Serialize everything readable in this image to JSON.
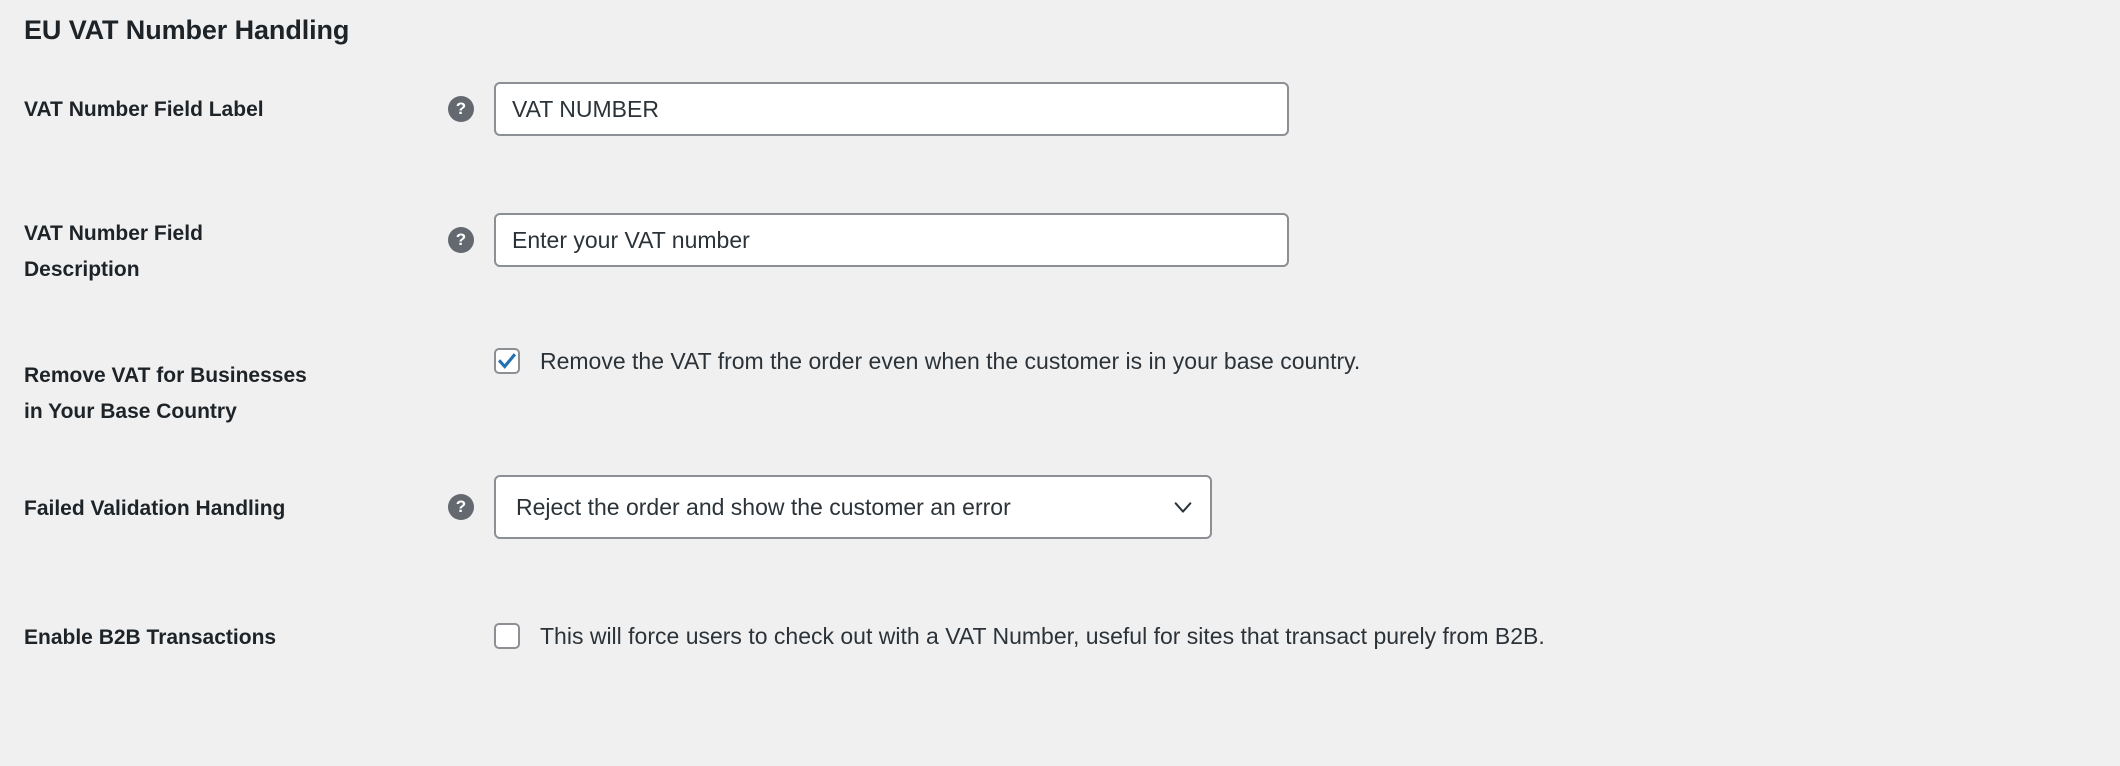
{
  "page": {
    "section_title": "EU VAT Number Handling",
    "background_color": "#f0f0f1",
    "text_color": "#1d2327",
    "border_color": "#8c8f94",
    "accent_color": "#2271b1",
    "help_icon_color": "#646970",
    "help_icon_glyph": "?"
  },
  "rows": {
    "vat_field_label": {
      "label": "VAT Number Field Label",
      "help": "?",
      "value": "VAT NUMBER",
      "placeholder": "VAT NUMBER"
    },
    "vat_field_description": {
      "label_line1": "VAT Number Field",
      "label_line2": "Description",
      "help": "?",
      "value": "Enter your VAT number",
      "placeholder": "Enter your VAT number"
    },
    "remove_vat_base_country": {
      "label_line1": "Remove VAT for Businesses",
      "label_line2": "in Your Base Country",
      "checkbox_label": "Remove the VAT from the order even when the customer is in your base country.",
      "checked": "true"
    },
    "failed_validation_handling": {
      "label": "Failed Validation Handling",
      "help": "?",
      "selected_option": "Reject the order and show the customer an error",
      "chevron": "chevron-down"
    },
    "enable_b2b_transactions": {
      "label": "Enable B2B Transactions",
      "checkbox_label": "This will force users to check out with a VAT Number, useful for sites that transact purely from B2B.",
      "checked": "false"
    }
  }
}
